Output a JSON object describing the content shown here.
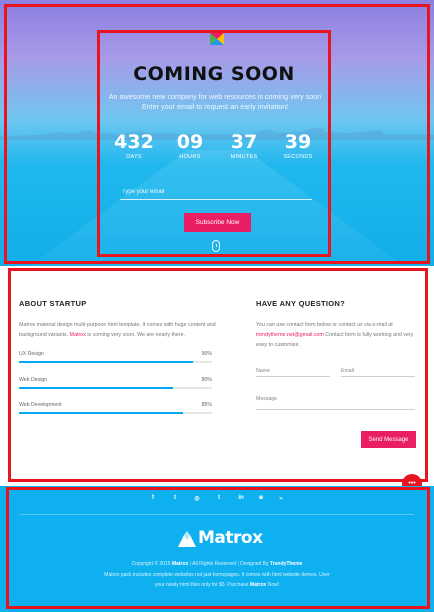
{
  "hero": {
    "title": "COMING SOON",
    "subtitle_line1": "An awesome new company for web resources is coming very soon",
    "subtitle_line2": "Enter your email to request an early invitation!",
    "countdown": [
      {
        "value": "432",
        "label": "DAYS"
      },
      {
        "value": "09",
        "label": "HOURS"
      },
      {
        "value": "37",
        "label": "MINUTES"
      },
      {
        "value": "39",
        "label": "SECONDS"
      }
    ],
    "email_placeholder": "Type your email",
    "subscribe_label": "Subscribe Now"
  },
  "about": {
    "title": "ABOUT STARTUP",
    "text_before": "Matrox material design multi-purpose html template. It comes with huge content and background variants.",
    "text_highlight": "Matrox",
    "text_after": "is coming very soon. We are nearly there.",
    "skills": [
      {
        "name": "UX Design",
        "percent_label": "90%",
        "percent": 90
      },
      {
        "name": "Web Design",
        "percent_label": "80%",
        "percent": 80
      },
      {
        "name": "Web Development",
        "percent_label": "85%",
        "percent": 85
      }
    ]
  },
  "question": {
    "title": "HAVE ANY QUESTION?",
    "text_before": "You can use contact form below or contact us via e-mail at",
    "email": "trendytheme.net@gmail.com",
    "text_after": "Contact form is fully working and very easy to customize.",
    "name_placeholder": "Name",
    "email_placeholder": "Email",
    "message_placeholder": "Message",
    "send_label": "Send Message"
  },
  "fab_label": "•••",
  "footer": {
    "social_icons": [
      {
        "name": "facebook-icon",
        "glyph": "f"
      },
      {
        "name": "twitter-icon",
        "glyph": "t"
      },
      {
        "name": "dribbble-icon",
        "glyph": "◎"
      },
      {
        "name": "tumblr-icon",
        "glyph": "t"
      },
      {
        "name": "linkedin-icon",
        "glyph": "in"
      },
      {
        "name": "instagram-icon",
        "glyph": "◙"
      },
      {
        "name": "rss-icon",
        "glyph": "⌁"
      }
    ],
    "brand": "Matrox",
    "copyright_prefix": "Copyright © 2015",
    "copyright_brand": "Matrox",
    "rights": "All Rights Reserved",
    "designed_prefix": "Designed By",
    "designer": "TrendyTheme",
    "desc_line1": "Matrox pack includes complete websites not just homepages. It comes with html website demos. User",
    "desc_line2_before": "your newly html files only for $5. Purchase",
    "desc_line2_brand": "Matrox",
    "desc_line2_after": "Now!"
  },
  "colors": {
    "accent_pink": "#e91e63",
    "footer_blue": "#0fb0ef",
    "progress_blue": "#03a9f4",
    "frame_red": "#e8141f"
  }
}
